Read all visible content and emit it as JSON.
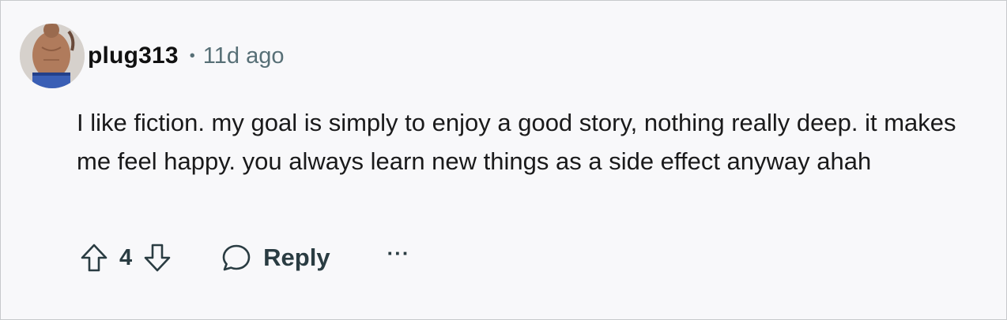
{
  "comment": {
    "username": "plug313",
    "separator": "•",
    "timestamp": "11d ago",
    "text": "I like fiction. my goal is simply to enjoy a good story, nothing really deep. it makes me feel happy. you always learn new things as a side effect anyway ahah",
    "vote_count": "4",
    "reply_label": "Reply",
    "more_label": "···"
  },
  "icons": {
    "avatar": "user-avatar",
    "upvote": "arrow-up-icon",
    "downvote": "arrow-down-icon",
    "reply": "speech-bubble-icon",
    "more": "more-options-icon"
  },
  "colors": {
    "background": "#f8f8fa",
    "border": "#c7c9cc",
    "text": "#1a1a1b",
    "meta": "#576f76",
    "action": "#2a3c42"
  }
}
